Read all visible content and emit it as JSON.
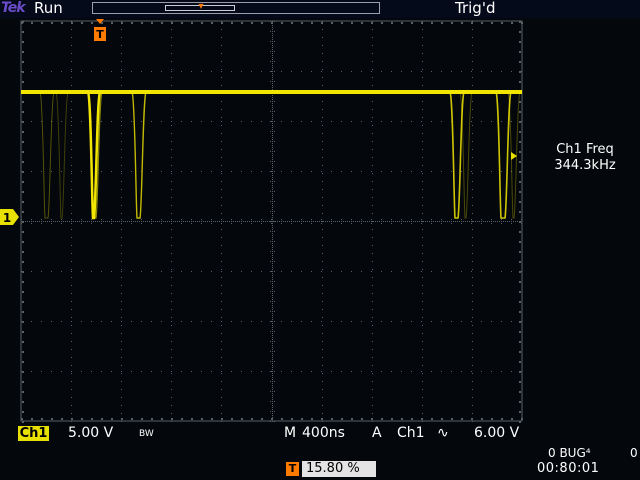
{
  "status": {
    "brand": "Tek",
    "run_state": "Run",
    "trigger_status": "Trig'd"
  },
  "readout": {
    "measurement_label": "Ch1 Freq",
    "measurement_value": "344.3kHz"
  },
  "channel": {
    "name": "Ch1",
    "scale": "5.00 V",
    "bw_limit": "BW",
    "ground_marker": "1"
  },
  "timebase": {
    "label": "M",
    "value": "400ns"
  },
  "trigger": {
    "mode_label": "A",
    "source": "Ch1",
    "slope_glyph": "∿",
    "level": "6.00 V",
    "position_marker": "T",
    "position_value": "15.80 %"
  },
  "system": {
    "bug_text": "0 BUG⁴",
    "bug_extra": "0",
    "clock": "00:80:01"
  },
  "colors": {
    "trace": "#f2e600",
    "grid": "#5a6068",
    "marker": "#ff7a00",
    "channel_box": "#e8e000"
  }
}
